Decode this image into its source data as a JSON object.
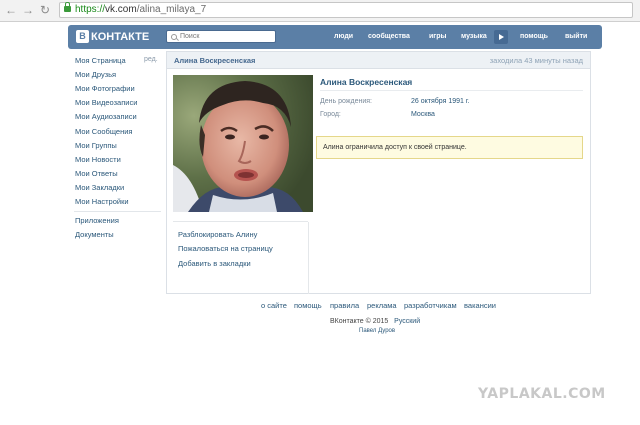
{
  "browser": {
    "url_scheme": "https://",
    "url_host": "vk.com",
    "url_path": "/alina_milaya_7"
  },
  "header": {
    "logo_text": "КОНТАКТЕ",
    "logo_letter": "В",
    "search_placeholder": "Поиск",
    "nav": [
      "люди",
      "сообщества",
      "игры",
      "музыка",
      "помощь",
      "выйти"
    ]
  },
  "sidebar": {
    "edit_label": "ред.",
    "items": [
      "Моя Страница",
      "Мои Друзья",
      "Мои Фотографии",
      "Мои Видеозаписи",
      "Мои Аудиозаписи",
      "Мои Сообщения",
      "Мои Группы",
      "Мои Новости",
      "Мои Ответы",
      "Мои Закладки",
      "Мои Настройки"
    ],
    "extra": [
      "Приложения",
      "Документы"
    ]
  },
  "profile": {
    "header_name": "Алина Воскресенская",
    "last_seen": "заходила 43 минуты назад",
    "name": "Алина Воскресенская",
    "birthday_label": "День рождения:",
    "birthday_value": "26 октября 1991 г.",
    "city_label": "Город:",
    "city_value": "Москва",
    "notice": "Алина ограничила доступ к своей странице.",
    "actions": [
      "Разблокировать Алину",
      "Пожаловаться на страницу",
      "Добавить в закладки"
    ]
  },
  "footer": {
    "links": [
      "о сайте",
      "помощь",
      "правила",
      "реклама",
      "разработчикам",
      "вакансии"
    ],
    "copyright": "ВКонтакте © 2015",
    "language": "Русский",
    "author": "Павел Дуров"
  },
  "watermark": "YAPLAKAL.COM",
  "colors": {
    "brand": "#5b7fa6",
    "link": "#2b587a",
    "notice_bg": "#fefbe1"
  }
}
